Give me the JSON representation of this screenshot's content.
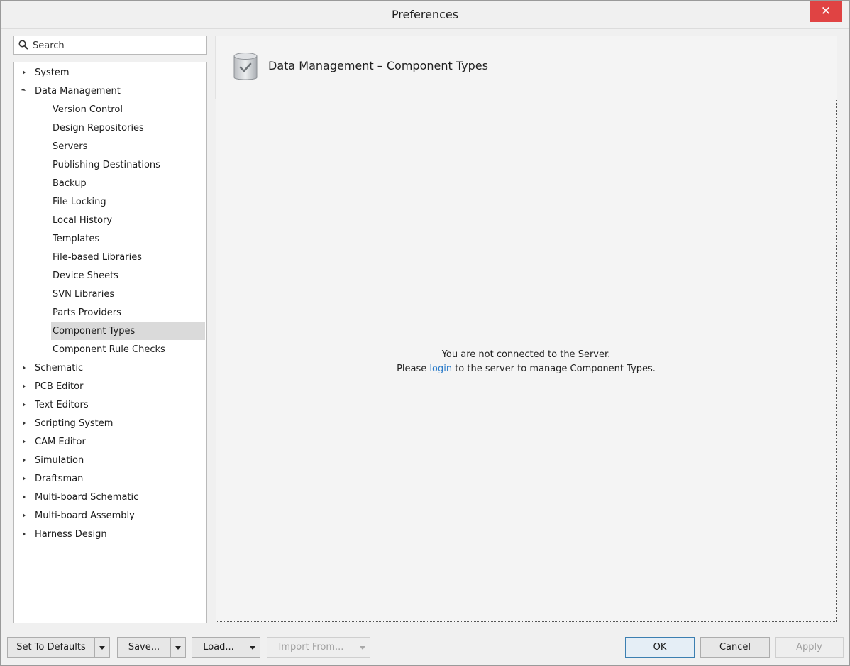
{
  "window": {
    "title": "Preferences",
    "close_label": "✕"
  },
  "search": {
    "placeholder": "Search"
  },
  "tree": {
    "items": [
      {
        "label": "System",
        "expanded": false
      },
      {
        "label": "Data Management",
        "expanded": true,
        "children": [
          "Version Control",
          "Design Repositories",
          "Servers",
          "Publishing Destinations",
          "Backup",
          "File Locking",
          "Local History",
          "Templates",
          "File-based Libraries",
          "Device Sheets",
          "SVN Libraries",
          "Parts Providers",
          "Component Types",
          "Component Rule Checks"
        ]
      },
      {
        "label": "Schematic",
        "expanded": false
      },
      {
        "label": "PCB Editor",
        "expanded": false
      },
      {
        "label": "Text Editors",
        "expanded": false
      },
      {
        "label": "Scripting System",
        "expanded": false
      },
      {
        "label": "CAM Editor",
        "expanded": false
      },
      {
        "label": "Simulation",
        "expanded": false
      },
      {
        "label": "Draftsman",
        "expanded": false
      },
      {
        "label": "Multi-board Schematic",
        "expanded": false
      },
      {
        "label": "Multi-board Assembly",
        "expanded": false
      },
      {
        "label": "Harness Design",
        "expanded": false
      }
    ],
    "selected": "Component Types"
  },
  "content": {
    "title": "Data Management – Component Types",
    "icon": "database-check-icon",
    "message_line1": "You are not connected to the Server.",
    "message_pre": "Please ",
    "message_link": "login",
    "message_post": " to the server to manage Component Types."
  },
  "footer": {
    "set_to_defaults": "Set To Defaults",
    "save": "Save...",
    "load": "Load...",
    "import_from": "Import From...",
    "ok": "OK",
    "cancel": "Cancel",
    "apply": "Apply"
  },
  "colors": {
    "close_button": "#e04343",
    "link": "#2a7bc9",
    "selected_row": "#dadada"
  }
}
